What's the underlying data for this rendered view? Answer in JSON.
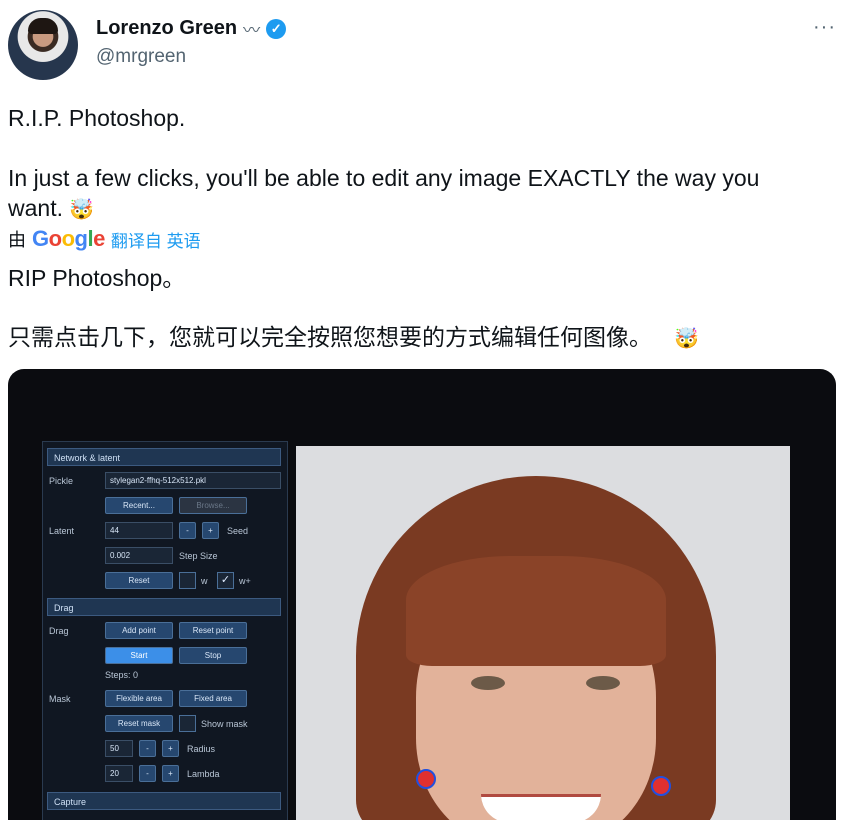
{
  "author": {
    "name": "Lorenzo Green",
    "name_suffix": "〰",
    "verified_mark": "✓",
    "handle": "@mrgreen"
  },
  "more_button": "···",
  "tweet": {
    "line1": "R.I.P. Photoshop.",
    "line2a": "In just a few clicks, you'll be able to edit any image EXACTLY the way you",
    "line2b": "want.",
    "emoji": "🤯"
  },
  "translation_bar": {
    "by": "由",
    "google": [
      "G",
      "o",
      "o",
      "g",
      "l",
      "e"
    ],
    "link": "翻译自 英语"
  },
  "translated": {
    "line1": "RIP Photoshop。",
    "line2": "只需点击几下，您就可以完全按照您想要的方式编辑任何图像。",
    "emoji": "🤯"
  },
  "media": {
    "sections": {
      "network": "Network & latent",
      "drag": "Drag",
      "capture": "Capture"
    },
    "labels": {
      "pickle": "Pickle",
      "latent": "Latent",
      "seed": "Seed",
      "step_size": "Step Size",
      "w": "w",
      "w_plus": "w+",
      "drag": "Drag",
      "steps": "Steps: 0",
      "mask": "Mask",
      "show_mask": "Show mask",
      "radius": "Radius",
      "lambda": "Lambda"
    },
    "fields": {
      "pickle": "stylegan2-ffhq-512x512.pkl",
      "latent": "44",
      "step": "0.002",
      "radius": "50",
      "lambda": "20"
    },
    "buttons": {
      "recent": "Recent...",
      "browse": "Browse...",
      "reset": "Reset",
      "add_point": "Add point",
      "reset_point": "Reset point",
      "start": "Start",
      "stop": "Stop",
      "flexible_area": "Flexible area",
      "fixed_area": "Fixed area",
      "reset_mask": "Reset mask",
      "minus": "-",
      "plus": "+"
    }
  },
  "colors": {
    "google": [
      "#4285F4",
      "#EA4335",
      "#FBBC05",
      "#4285F4",
      "#34A853",
      "#EA4335"
    ],
    "accent": "#1d9bf0"
  }
}
